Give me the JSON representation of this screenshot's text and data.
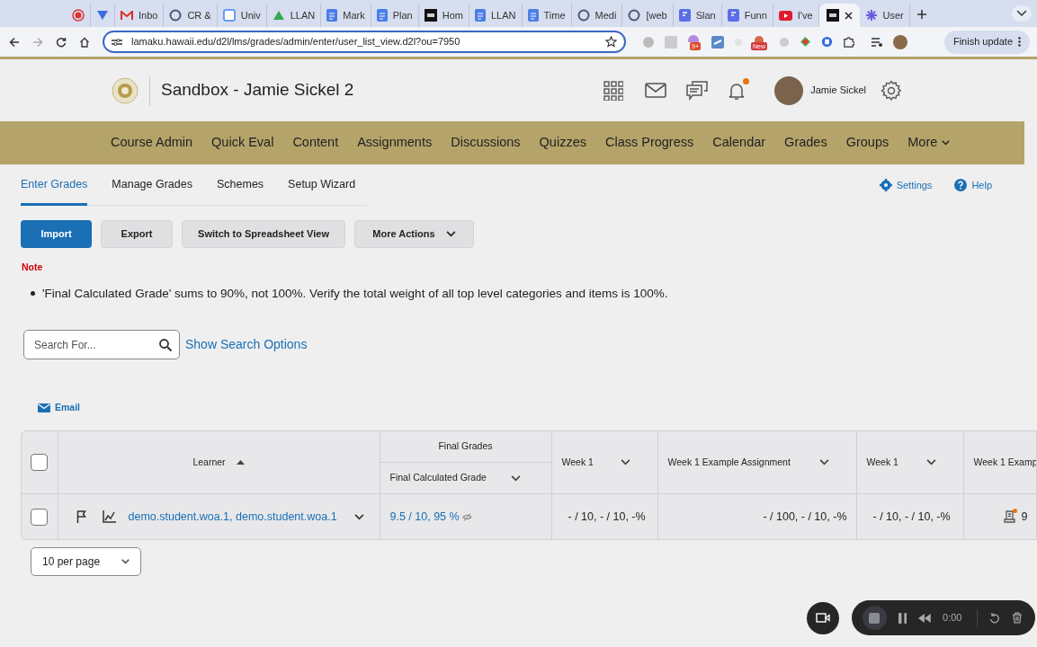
{
  "browser": {
    "tabs": [
      {
        "selected": false,
        "kind": "record"
      },
      {
        "selected": false,
        "kind": "vee"
      },
      {
        "label": "Inbo",
        "selected": false,
        "kind": "mail"
      },
      {
        "label": "CR &",
        "selected": false,
        "kind": "ring"
      },
      {
        "label": "Univ",
        "selected": false,
        "kind": "calendar"
      },
      {
        "label": "LLAN",
        "selected": false,
        "kind": "drive"
      },
      {
        "label": "Mark",
        "selected": false,
        "kind": "doc"
      },
      {
        "label": "Plan",
        "selected": false,
        "kind": "doc"
      },
      {
        "label": "Hom",
        "selected": false,
        "kind": "square"
      },
      {
        "label": "LLAN",
        "selected": false,
        "kind": "doc"
      },
      {
        "label": "Time",
        "selected": false,
        "kind": "doc"
      },
      {
        "label": "Medi",
        "selected": false,
        "kind": "ring"
      },
      {
        "label": "[web",
        "selected": false,
        "kind": "ring"
      },
      {
        "label": "Slan",
        "selected": false,
        "kind": "form"
      },
      {
        "label": "Funn",
        "selected": false,
        "kind": "form"
      },
      {
        "label": "I've",
        "selected": false,
        "kind": "video"
      },
      {
        "selected": true,
        "kind": "square"
      },
      {
        "label": "User",
        "selected": false,
        "kind": "star"
      }
    ],
    "url": "lamaku.hawaii.edu/d2l/lms/grades/admin/enter/user_list_view.d2l?ou=7950",
    "extension_badges": [
      "9+",
      "New"
    ],
    "update_button": "Finish update"
  },
  "header": {
    "course_title": "Sandbox - Jamie Sickel 2",
    "user_name": "Jamie Sickel",
    "notification_dot": true
  },
  "nav": {
    "items": [
      "Course Admin",
      "Quick Eval",
      "Content",
      "Assignments",
      "Discussions",
      "Quizzes",
      "Class Progress",
      "Calendar",
      "Grades",
      "Groups"
    ],
    "more": "More"
  },
  "subtabs": [
    {
      "label": "Enter Grades",
      "selected": true
    },
    {
      "label": "Manage Grades",
      "selected": false
    },
    {
      "label": "Schemes",
      "selected": false
    },
    {
      "label": "Setup Wizard",
      "selected": false
    }
  ],
  "settings": "Settings",
  "help": "Help",
  "actions": [
    {
      "label": "Import",
      "kind": "primary"
    },
    {
      "label": "Export",
      "kind": "secondary"
    },
    {
      "label": "Switch to Spreadsheet View",
      "kind": "secondary"
    },
    {
      "label": "More Actions",
      "kind": "menu"
    }
  ],
  "note": {
    "title": "Note",
    "items": [
      "'Final Calculated Grade' sums to 90%, not 100%. Verify the total weight of all top level categories and items is 100%."
    ]
  },
  "search": {
    "placeholder": "Search For...",
    "options_link": "Show Search Options"
  },
  "email": "Email",
  "table": {
    "group_header": "Final Grades",
    "columns": [
      {
        "label": "Learner",
        "kind": "sort"
      },
      {
        "label": "Final Calculated Grade",
        "kind": "menu"
      },
      {
        "label": "Week 1",
        "kind": "menu"
      },
      {
        "label": "Week 1 Example Assignment",
        "kind": "menu"
      },
      {
        "label": "Week 1",
        "kind": "menu"
      },
      {
        "label": "Week 1 Examp",
        "kind": "plain"
      }
    ],
    "header_checked": false,
    "rows": [
      {
        "checked": false,
        "cells": [
          "demo.student.woa.1, demo.student.woa.1",
          "9.5 / 10, 95 %",
          "- / 10, - / 10, -%",
          "- / 100, - / 10, -%",
          "- / 10, - / 10, -%",
          "9"
        ]
      }
    ]
  },
  "per_page": "10 per page",
  "recorder": {
    "time": "0:00"
  }
}
